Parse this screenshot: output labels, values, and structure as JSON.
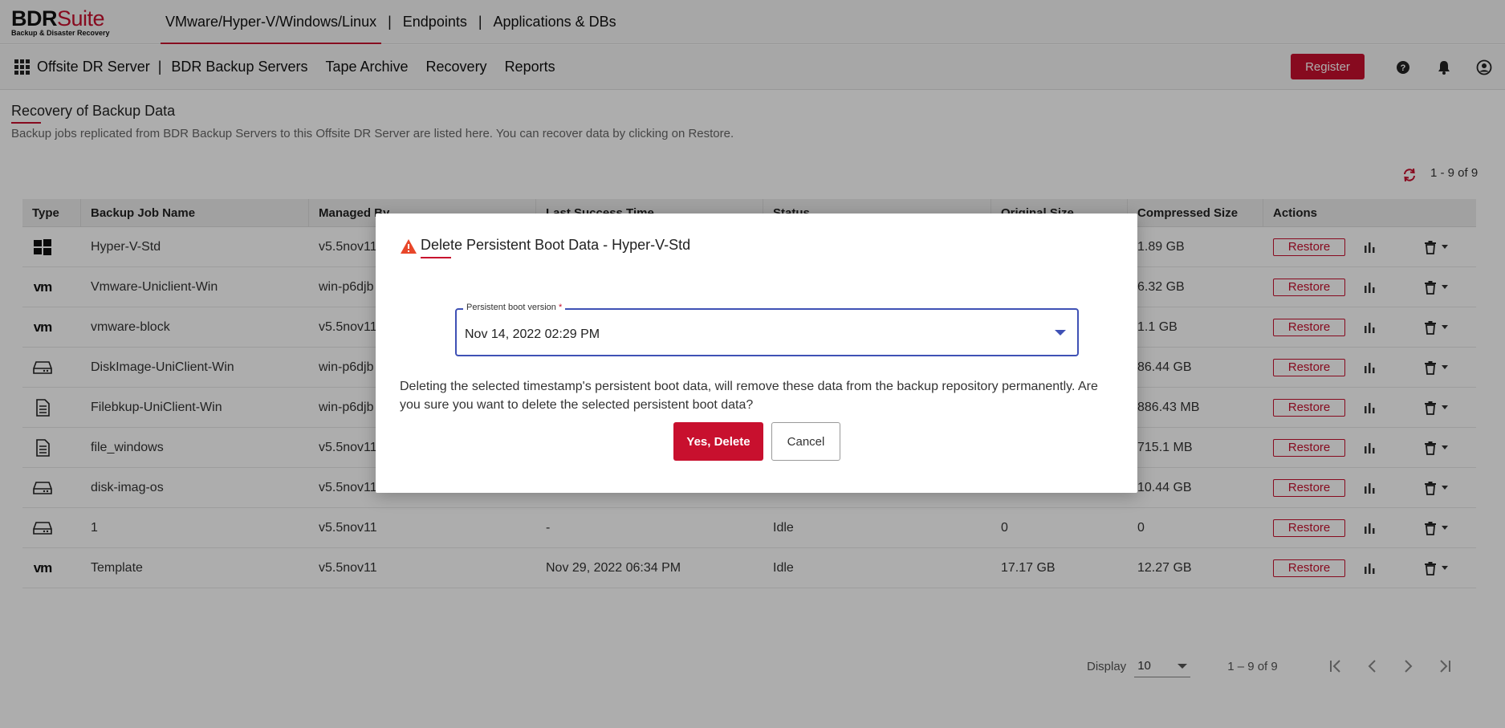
{
  "brand": {
    "name_part1": "BDR",
    "name_part2": "Suite",
    "tagline": "Backup & Disaster Recovery",
    "accent": "#c8102e"
  },
  "product_nav": {
    "items": [
      "VMware/Hyper-V/Windows/Linux",
      "Endpoints",
      "Applications & DBs"
    ],
    "active_index": 0
  },
  "sub_nav": {
    "server_label": "Offsite DR Server",
    "items": [
      "BDR Backup Servers",
      "Tape Archive",
      "Recovery",
      "Reports"
    ],
    "register_label": "Register",
    "icons": [
      "help-icon",
      "bell-icon",
      "user-account-icon"
    ]
  },
  "page": {
    "title": "Recovery of Backup Data",
    "description": "Backup jobs replicated from BDR Backup Servers to this Offsite DR Server are listed here. You can recover data by clicking on Restore.",
    "count_text": "1 - 9 of 9"
  },
  "table": {
    "headers": [
      "Type",
      "Backup Job Name",
      "Managed By",
      "Last Success Time",
      "Status",
      "Original Size",
      "Compressed Size",
      "Actions"
    ],
    "restore_label": "Restore",
    "rows": [
      {
        "type": "windows",
        "name": "Hyper-V-Std",
        "managed": "v5.5nov11",
        "last": "",
        "status": "",
        "orig": "",
        "comp": "1.89 GB"
      },
      {
        "type": "vm",
        "name": "Vmware-Uniclient-Win",
        "managed": "win-p6djb",
        "last": "",
        "status": "",
        "orig": "",
        "comp": "6.32 GB"
      },
      {
        "type": "vm",
        "name": "vmware-block",
        "managed": "v5.5nov11",
        "last": "",
        "status": "",
        "orig": "",
        "comp": "1.1 GB"
      },
      {
        "type": "disk",
        "name": "DiskImage-UniClient-Win",
        "managed": "win-p6djb",
        "last": "",
        "status": "",
        "orig": "",
        "comp": "86.44 GB"
      },
      {
        "type": "file",
        "name": "Filebkup-UniClient-Win",
        "managed": "win-p6djb",
        "last": "",
        "status": "",
        "orig": "",
        "comp": "886.43 MB"
      },
      {
        "type": "file",
        "name": "file_windows",
        "managed": "v5.5nov11",
        "last": "",
        "status": "",
        "orig": "",
        "comp": "715.1 MB"
      },
      {
        "type": "disk",
        "name": "disk-imag-os",
        "managed": "v5.5nov11",
        "last": "",
        "status": "",
        "orig": "",
        "comp": "10.44 GB"
      },
      {
        "type": "disk",
        "name": "1",
        "managed": "v5.5nov11",
        "last": "-",
        "status": "Idle",
        "orig": "0",
        "comp": "0"
      },
      {
        "type": "vm",
        "name": "Template",
        "managed": "v5.5nov11",
        "last": "Nov 29, 2022 06:34 PM",
        "status": "Idle",
        "orig": "17.17 GB",
        "comp": "12.27 GB"
      }
    ]
  },
  "pagination": {
    "display_label": "Display",
    "page_size": "10",
    "range_text": "1 – 9 of 9"
  },
  "modal": {
    "title": "Delete Persistent Boot Data - Hyper-V-Std",
    "field_label": "Persistent boot version",
    "field_required_mark": "*",
    "field_value": "Nov 14, 2022 02:29 PM",
    "message": "Deleting the selected timestamp's persistent boot data, will remove these data from the backup repository permanently. Are you sure you want to delete the selected persistent boot data?",
    "confirm_label": "Yes, Delete",
    "cancel_label": "Cancel"
  }
}
